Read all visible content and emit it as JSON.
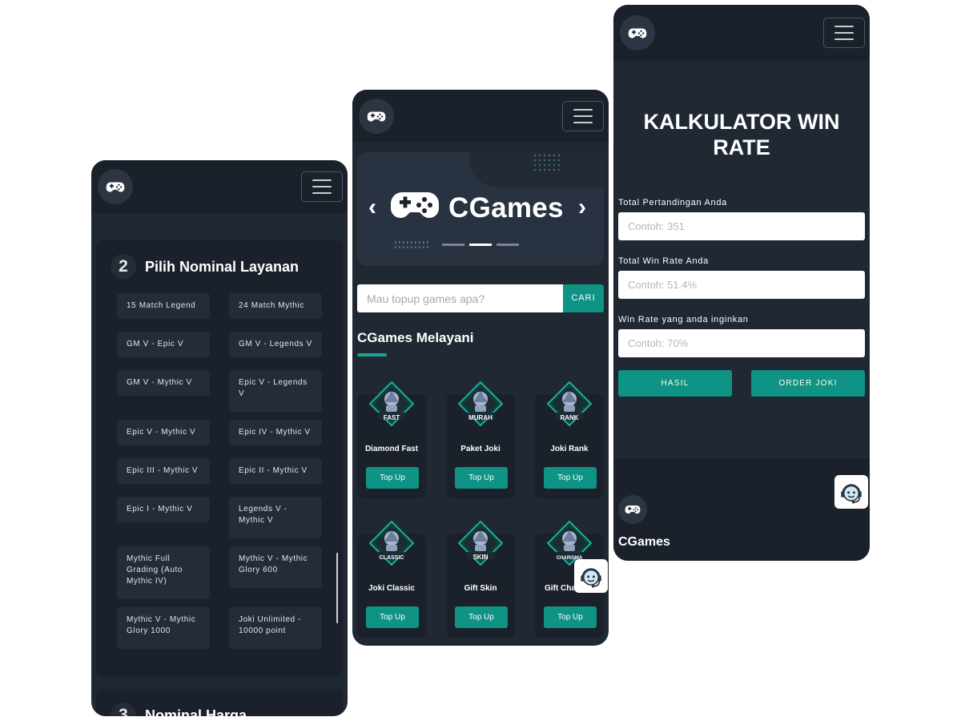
{
  "icons": {
    "logo": "gamepad-icon",
    "menu": "hamburger-menu-icon",
    "support": "customer-service-headset-icon"
  },
  "colors": {
    "accent": "#0e9384",
    "background": "#1f2833",
    "navbar": "#1a212a"
  },
  "order_page": {
    "step2": {
      "number": "2",
      "title": "Pilih Nominal Layanan"
    },
    "options": [
      "15 Match Legend",
      "24 Match Mythic",
      "GM V - Epic V",
      "GM V - Legends V",
      "GM V - Mythic V",
      "Epic V - Legends V",
      "Epic V - Mythic V",
      "Epic IV - Mythic V",
      "Epic III - Mythic V",
      "Epic II - Mythic V",
      "Epic I - Mythic V",
      "Legends V - Mythic V",
      "Mythic Full Grading (Auto Mythic IV)",
      "Mythic V - Mythic Glory 600",
      "Mythic V - Mythic Glory 1000",
      "Joki Unlimited - 10000 point"
    ],
    "step3": {
      "number": "3",
      "title": "Nominal Harga"
    }
  },
  "home_page": {
    "banner": {
      "brand": "CGames",
      "prev": "‹",
      "next": "›",
      "active_slide": 2,
      "slides": 3
    },
    "search": {
      "placeholder": "Mau topup games apa?",
      "button": "CARI"
    },
    "section_title": "CGames Melayani",
    "services": [
      {
        "name": "Diamond Fast",
        "badge": "FAST",
        "button": "Top Up"
      },
      {
        "name": "Paket Joki",
        "badge": "MURAH",
        "button": "Top Up"
      },
      {
        "name": "Joki Rank",
        "badge": "RANK",
        "button": "Top Up"
      },
      {
        "name": "Joki Classic",
        "badge": "CLASSIC",
        "button": "Top Up"
      },
      {
        "name": "Gift Skin",
        "badge": "SKIN",
        "button": "Top Up"
      },
      {
        "name": "Gift Cha",
        "badge": "CHARISMA",
        "button": "Top Up"
      }
    ]
  },
  "calculator_page": {
    "title_line1": "KALKULATOR WIN",
    "title_line2": "RATE",
    "fields": [
      {
        "label": "Total Pertandingan Anda",
        "placeholder": "Contoh: 351"
      },
      {
        "label": "Total Win Rate Anda",
        "placeholder": "Contoh: 51.4%"
      },
      {
        "label": "Win Rate yang anda inginkan",
        "placeholder": "Contoh: 70%"
      }
    ],
    "buttons": {
      "result": "HASIL",
      "order": "ORDER JOKI"
    },
    "footer_brand": "CGames"
  }
}
